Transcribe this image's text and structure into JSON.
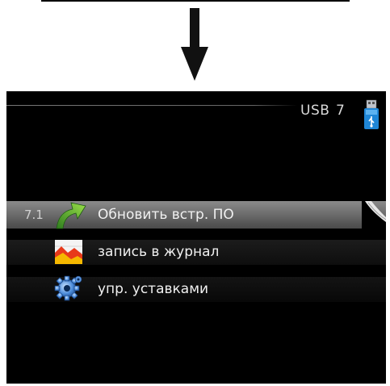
{
  "header": {
    "title": "USB",
    "menu_number": "7"
  },
  "menu": {
    "items": [
      {
        "number": "7.1",
        "label": "Обновить встр. ПО",
        "icon": "green-arrow-icon",
        "selected": true
      },
      {
        "number": "",
        "label": "запись в журнал",
        "icon": "chart-icon",
        "selected": false
      },
      {
        "number": "",
        "label": "упр. уставками",
        "icon": "gear-icon",
        "selected": false
      }
    ]
  },
  "colors": {
    "screen": "#000000",
    "selected_row": "#7a7a7a",
    "text": "#f0f0f0",
    "arrow": "#111111"
  }
}
